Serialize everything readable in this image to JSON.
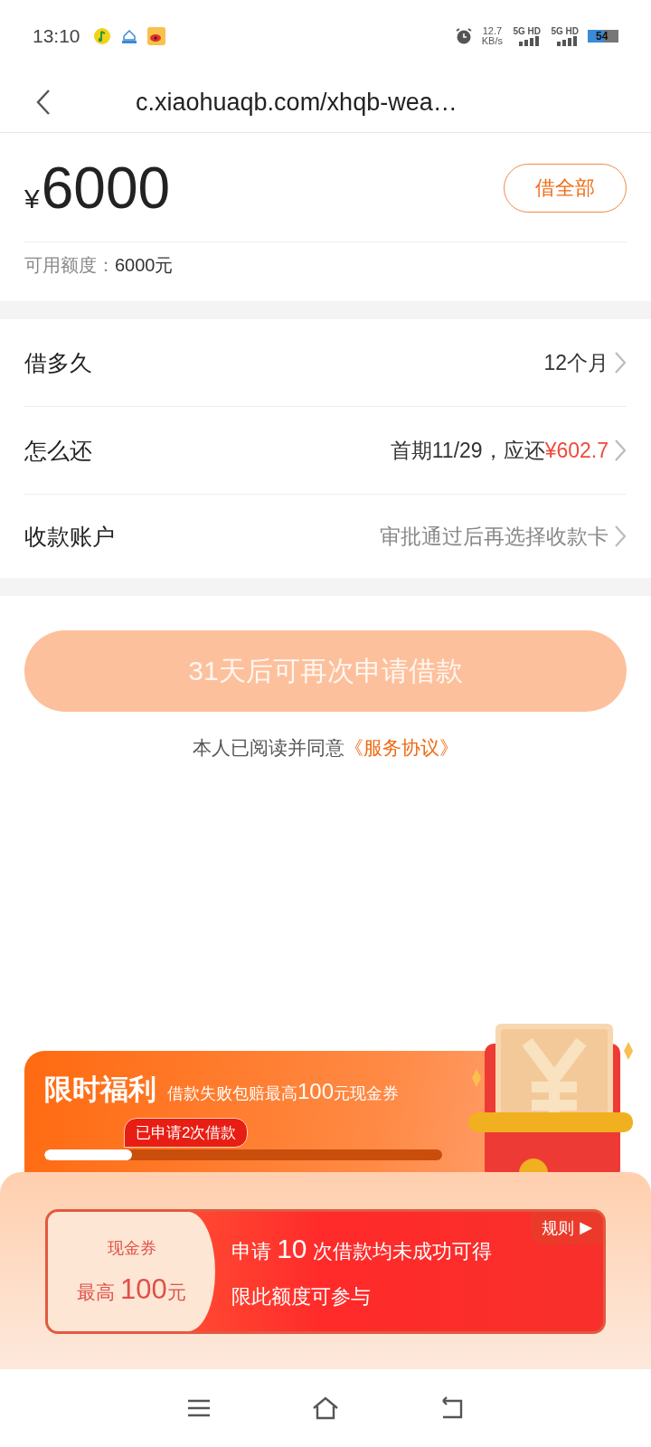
{
  "status_bar": {
    "time": "13:10",
    "net_speed": "12.7",
    "net_unit": "KB/s",
    "sims": [
      {
        "label": "5G HD"
      },
      {
        "label": "5G HD"
      }
    ],
    "battery": "54"
  },
  "nav": {
    "url": "c.xiaohuaqb.com/xhqb-wea…"
  },
  "amount": {
    "currency": "¥",
    "value": "6000",
    "button": "借全部",
    "available_label": "可用额度：",
    "available_value": "6000元"
  },
  "rows": [
    {
      "label": "借多久",
      "kind": "value",
      "value": "12个月"
    },
    {
      "label": "怎么还",
      "kind": "value",
      "value": "首期11/29，应还",
      "amount": "¥602.7"
    },
    {
      "label": "收款账户",
      "kind": "hint",
      "value": "审批通过后再选择收款卡"
    }
  ],
  "submit_button": {
    "label": "31天后可再次申请借款",
    "disabled": true
  },
  "agreement": {
    "text": "本人已阅读并同意",
    "link": "《服务协议》"
  },
  "promo": {
    "title": "限时福利",
    "subtitle": "借款失败包赔最高**100**元现金券",
    "badge": "已申请2次借款",
    "level": 0.22
  },
  "coupon": {
    "label": "现金券",
    "amount": "最高 **100**元",
    "line1": "申请 **10** 次借款均未成功可得",
    "line2": "限此额度可参与",
    "rules": "规则",
    "rules_arrow": "▶"
  }
}
